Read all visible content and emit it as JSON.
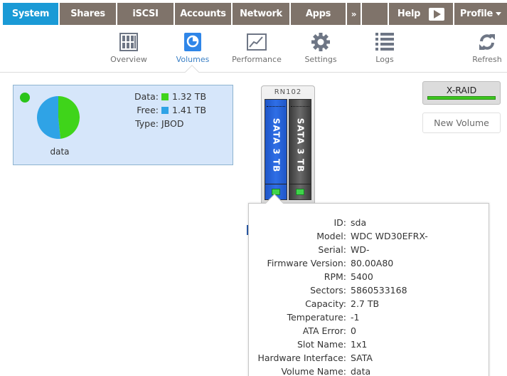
{
  "topnav": {
    "tabs": [
      {
        "label": "System",
        "active": true
      },
      {
        "label": "Shares"
      },
      {
        "label": "iSCSI"
      },
      {
        "label": "Accounts"
      },
      {
        "label": "Network"
      },
      {
        "label": "Apps"
      },
      {
        "label": "»"
      }
    ],
    "help_label": "Help",
    "profile_label": "Profile"
  },
  "subnav": {
    "items": [
      {
        "label": "Overview",
        "icon": "overview-grid-icon"
      },
      {
        "label": "Volumes",
        "icon": "volumes-pie-icon",
        "active": true
      },
      {
        "label": "Performance",
        "icon": "performance-chart-icon"
      },
      {
        "label": "Settings",
        "icon": "gear-icon"
      },
      {
        "label": "Logs",
        "icon": "list-icon"
      },
      {
        "label": "Refresh",
        "icon": "refresh-icon"
      }
    ]
  },
  "volume": {
    "name": "data",
    "status_color": "#2ac41a",
    "data_label": "Data:",
    "data_value": "1.32 TB",
    "data_color": "#3fd41a",
    "free_label": "Free:",
    "free_value": "1.41 TB",
    "free_color": "#2fa3e6",
    "type_label": "Type:",
    "type_value": "JBOD",
    "used_fraction": 0.4835
  },
  "chassis": {
    "model": "RN102",
    "bays": [
      {
        "label": "SATA 3 TB",
        "selected": true
      },
      {
        "label": "SATA 3 TB",
        "selected": false
      }
    ]
  },
  "actions": {
    "xraid_label": "X-RAID",
    "new_volume_label": "New Volume"
  },
  "disk_popup": {
    "rows": [
      {
        "k": "ID:",
        "v": "sda"
      },
      {
        "k": "Model:",
        "v": "WDC WD30EFRX-"
      },
      {
        "k": "Serial:",
        "v": "WD-"
      },
      {
        "k": "Firmware Version:",
        "v": "80.00A80"
      },
      {
        "k": "RPM:",
        "v": "5400"
      },
      {
        "k": "Sectors:",
        "v": "5860533168"
      },
      {
        "k": "Capacity:",
        "v": "2.7 TB"
      },
      {
        "k": "Temperature:",
        "v": "-1"
      },
      {
        "k": "ATA Error:",
        "v": "0"
      },
      {
        "k": "Slot Name:",
        "v": "1x1"
      },
      {
        "k": "Hardware Interface:",
        "v": "SATA"
      },
      {
        "k": "Volume Name:",
        "v": "data"
      }
    ]
  }
}
